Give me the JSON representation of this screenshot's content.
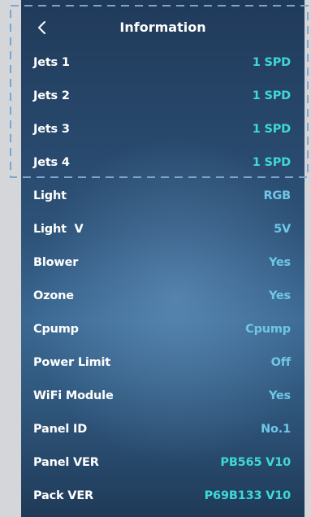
{
  "header": {
    "title": "Information",
    "back_icon": "chevron-left-icon"
  },
  "colors": {
    "label": "#ffffff",
    "value_primary": "#3fd8d6",
    "value_secondary": "#6fc6e6",
    "highlight_border": "#7aa6cf"
  },
  "info_items": [
    {
      "label": "Jets 1",
      "value": "1 SPD"
    },
    {
      "label": "Jets 2",
      "value": "1 SPD"
    },
    {
      "label": "Jets 3",
      "value": "1 SPD"
    },
    {
      "label": "Jets 4",
      "value": "1 SPD"
    },
    {
      "label": "Light",
      "value": "RGB"
    },
    {
      "label": "Light  V",
      "value": "5V"
    },
    {
      "label": "Blower",
      "value": "Yes"
    },
    {
      "label": "Ozone",
      "value": "Yes"
    },
    {
      "label": "Cpump",
      "value": "Cpump"
    },
    {
      "label": "Power Limit",
      "value": "Off"
    },
    {
      "label": "WiFi Module",
      "value": "Yes"
    },
    {
      "label": "Panel ID",
      "value": "No.1"
    },
    {
      "label": "Panel VER",
      "value": "PB565 V10"
    },
    {
      "label": "Pack VER",
      "value": "P69B133 V10"
    }
  ]
}
